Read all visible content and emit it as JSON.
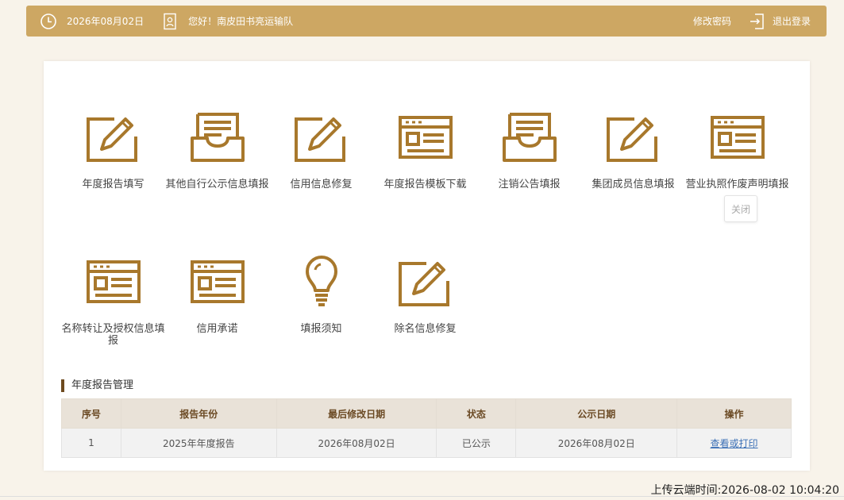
{
  "topbar": {
    "date": "2026年08月02日",
    "greeting": "您好！南皮田书亮运输队",
    "change_password": "修改密码",
    "logout": "退出登录",
    "clock_icon": "clock-icon",
    "user_icon": "user-card-icon",
    "logout_icon": "logout-icon"
  },
  "tiles": [
    {
      "label": "年度报告填写",
      "icon": "edit-icon"
    },
    {
      "label": "其他自行公示信息填报",
      "icon": "inbox-icon"
    },
    {
      "label": "信用信息修复",
      "icon": "edit-icon"
    },
    {
      "label": "年度报告模板下载",
      "icon": "window-form-icon"
    },
    {
      "label": "注销公告填报",
      "icon": "inbox-icon"
    },
    {
      "label": "集团成员信息填报",
      "icon": "edit-icon"
    },
    {
      "label": "营业执照作废声明填报",
      "icon": "window-form-icon"
    },
    {
      "label": "名称转让及授权信息填报",
      "icon": "window-form-icon"
    },
    {
      "label": "信用承诺",
      "icon": "window-form-icon"
    },
    {
      "label": "填报须知",
      "icon": "lightbulb-icon"
    },
    {
      "label": "除名信息修复",
      "icon": "edit-icon"
    }
  ],
  "close_label": "关闭",
  "section": {
    "title": "年度报告管理",
    "columns": [
      "序号",
      "报告年份",
      "最后修改日期",
      "状态",
      "公示日期",
      "操作"
    ],
    "rows": [
      [
        "1",
        "2025年年度报告",
        "2026年08月02日",
        "已公示",
        "2026年08月02日",
        "查看或打印"
      ]
    ]
  },
  "footer": {
    "upload_time": "上传云端时间:2026-08-02 10:04:20"
  },
  "colors": {
    "accent": "#cda763",
    "icon": "#a8782c"
  }
}
